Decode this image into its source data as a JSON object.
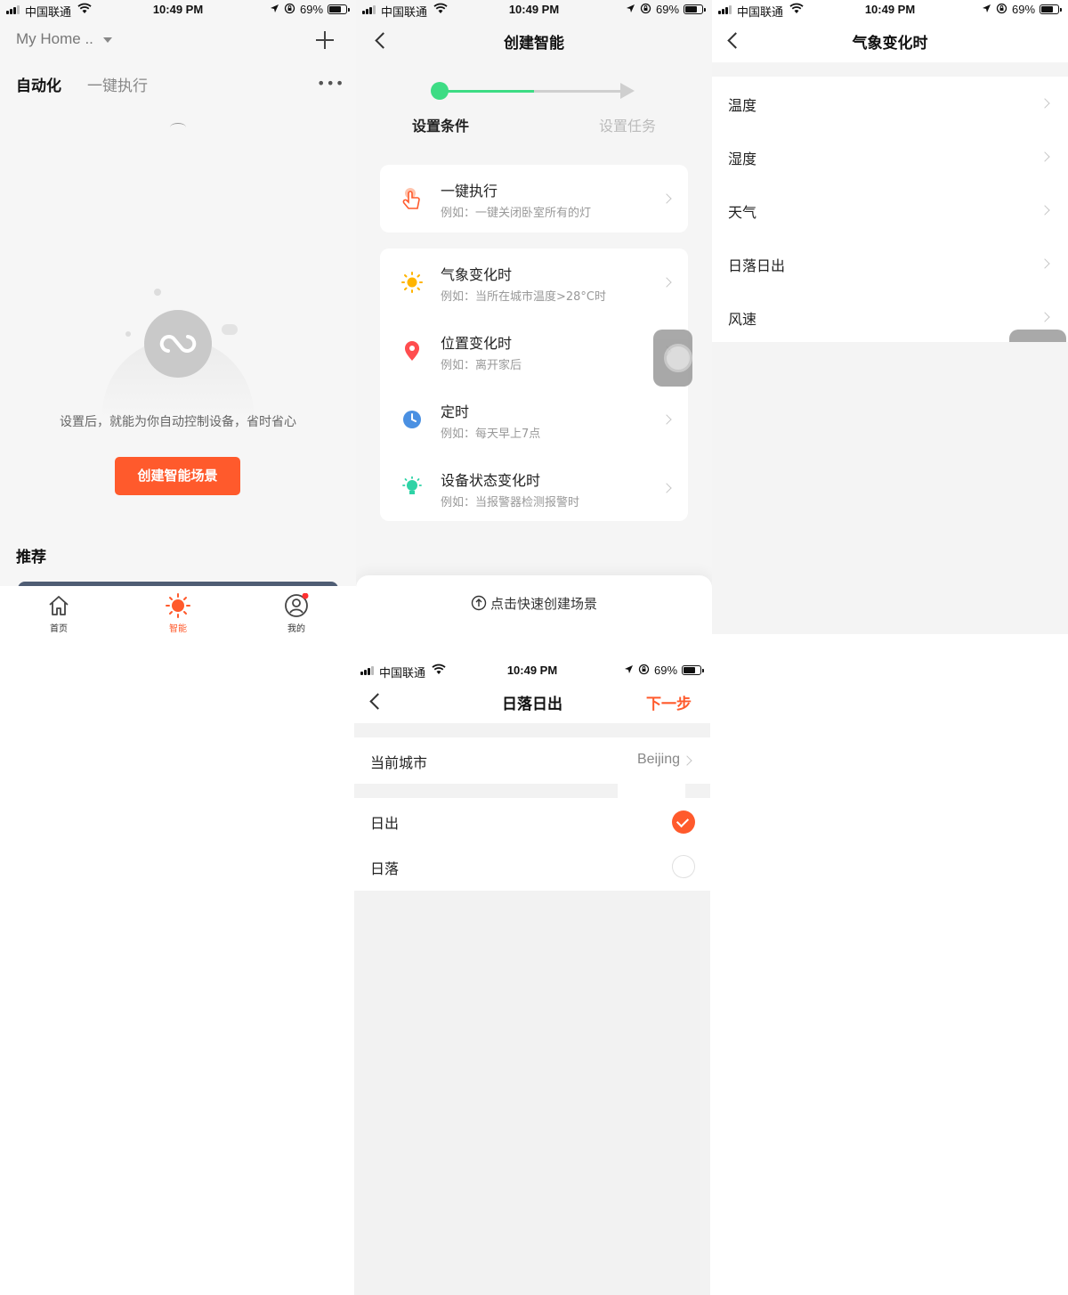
{
  "status": {
    "carrier": "中国联通",
    "time": "10:49 PM",
    "battery": "69%"
  },
  "screen1": {
    "home_label": "My Home ..",
    "tabs": [
      "自动化",
      "一键执行"
    ],
    "empty_text": "设置后，就能为你自动控制设备，省时省心",
    "create_button": "创建智能场景",
    "recommend": "推荐",
    "bottom_nav": [
      {
        "label": "首页",
        "icon": "home-icon"
      },
      {
        "label": "智能",
        "icon": "sun-icon"
      },
      {
        "label": "我的",
        "icon": "profile-icon"
      }
    ],
    "colors": {
      "accent": "#ff5a2c",
      "active_nav": "#ff5a2c"
    }
  },
  "screen2": {
    "title": "创建智能",
    "step1": "设置条件",
    "step2": "设置任务",
    "items": [
      {
        "title": "一键执行",
        "desc": "例如：一键关闭卧室所有的灯",
        "icon": "tap-hand-icon"
      },
      {
        "title": "气象变化时",
        "desc": "例如：当所在城市温度>28°C时",
        "icon": "sun-icon"
      },
      {
        "title": "位置变化时",
        "desc": "例如：离开家后",
        "icon": "location-pin-icon"
      },
      {
        "title": "定时",
        "desc": "例如：每天早上7点",
        "icon": "clock-icon"
      },
      {
        "title": "设备状态变化时",
        "desc": "例如：当报警器检测报警时",
        "icon": "bulb-icon"
      }
    ],
    "quick_create": "点击快速创建场景",
    "colors": {
      "progress": "#3ddc84"
    }
  },
  "screen3": {
    "title": "气象变化时",
    "items": [
      "温度",
      "湿度",
      "天气",
      "日落日出",
      "风速"
    ]
  },
  "screen4": {
    "title": "日落日出",
    "next": "下一步",
    "city_label": "当前城市",
    "city_value": "Beijing",
    "options": [
      {
        "label": "日出",
        "checked": true
      },
      {
        "label": "日落",
        "checked": false
      }
    ],
    "colors": {
      "accent": "#ff5a2c"
    }
  }
}
